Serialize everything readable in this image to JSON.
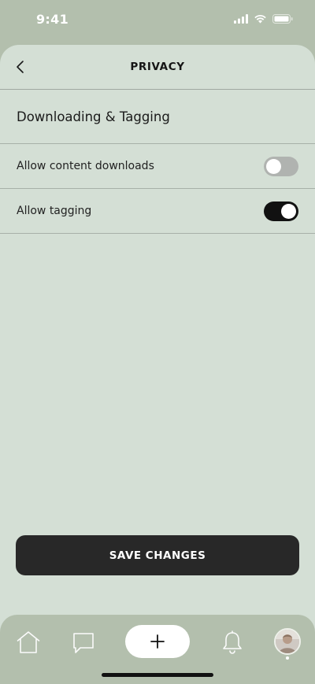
{
  "status_bar": {
    "time": "9:41"
  },
  "header": {
    "title": "PRIVACY",
    "back_icon": "chevron-left-icon"
  },
  "section": {
    "title": "Downloading & Tagging"
  },
  "settings": [
    {
      "label": "Allow content downloads",
      "enabled": false
    },
    {
      "label": "Allow tagging",
      "enabled": true
    }
  ],
  "actions": {
    "save_label": "SAVE CHANGES"
  },
  "tab_bar": {
    "items": [
      {
        "icon": "home-icon"
      },
      {
        "icon": "chat-bubble-icon"
      },
      {
        "icon": "plus-icon"
      },
      {
        "icon": "bell-icon"
      },
      {
        "icon": "avatar"
      }
    ]
  },
  "colors": {
    "background": "#b3bfad",
    "card": "#d4dfd5",
    "toggle_on": "#111111",
    "toggle_off": "#b0b3b0",
    "button": "#282828"
  }
}
